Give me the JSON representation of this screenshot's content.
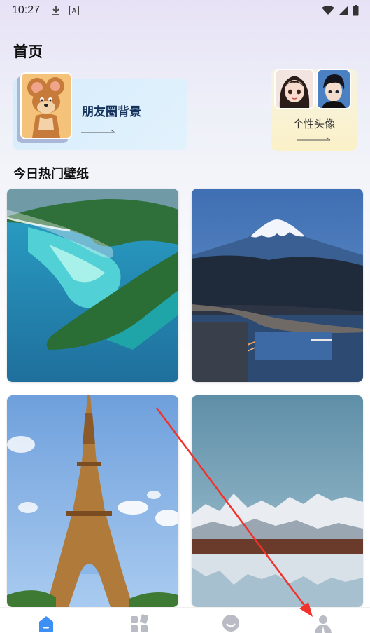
{
  "status_bar": {
    "time": "10:27"
  },
  "page": {
    "title": "首页"
  },
  "feature_cards": [
    {
      "label": "朋友圈背景",
      "icon": "cartoon-mouse-thumbnail"
    },
    {
      "label": "个性头像",
      "icon": "avatar-thumbnails"
    }
  ],
  "section": {
    "title": "今日热门壁纸"
  },
  "wallpapers": [
    {
      "subject": "tropical-island-aerial"
    },
    {
      "subject": "mount-fuji-coastal-town"
    },
    {
      "subject": "eiffel-tower"
    },
    {
      "subject": "snowy-mountains-reflection"
    }
  ],
  "tab_bar": [
    {
      "icon": "home-icon",
      "active": true
    },
    {
      "icon": "category-icon",
      "active": false
    },
    {
      "icon": "smile-icon",
      "active": false
    },
    {
      "icon": "profile-icon",
      "active": false
    }
  ],
  "colors": {
    "accent": "#3b8ff5",
    "tab_inactive": "#b9bcc4",
    "annotation_arrow": "#f0322a"
  }
}
